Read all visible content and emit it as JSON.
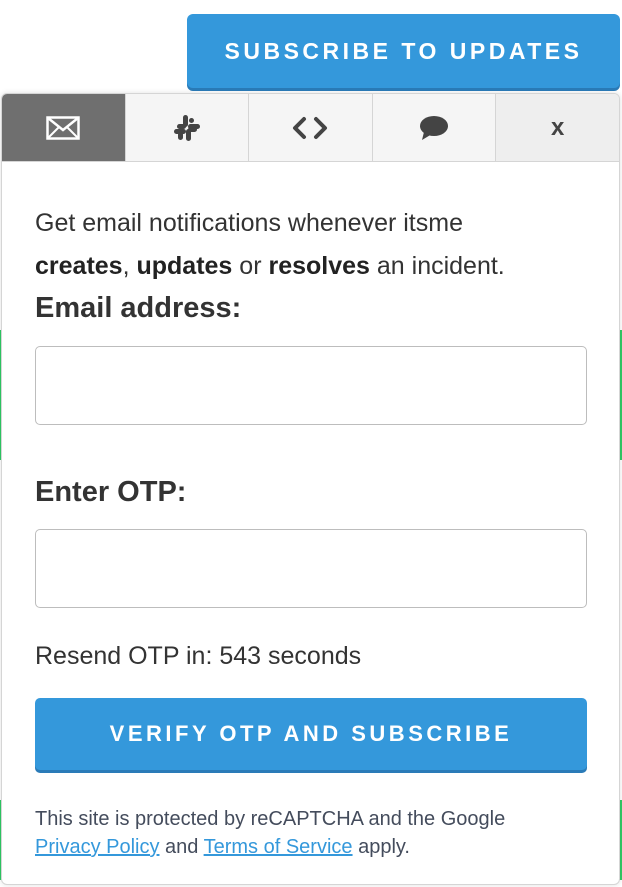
{
  "header": {
    "subscribe_label": "SUBSCRIBE TO UPDATES"
  },
  "tabs": [
    {
      "icon": "email-icon",
      "active": true
    },
    {
      "icon": "slack-icon",
      "active": false
    },
    {
      "icon": "code-icon",
      "active": false
    },
    {
      "icon": "chat-bubble-icon",
      "active": false
    },
    {
      "icon": "close-icon",
      "label": "x",
      "active": false
    }
  ],
  "intro": {
    "prefix": "Get email notifications whenever itsme",
    "w1": "creates",
    "sep1": ", ",
    "w2": "updates",
    "sep2": " or ",
    "w3": "resolves",
    "suffix": " an incident."
  },
  "form": {
    "email_label": "Email address:",
    "email_value": "",
    "otp_label": "Enter OTP:",
    "otp_value": "",
    "resend_text": "Resend OTP in: 543 seconds",
    "verify_label": "VERIFY OTP AND SUBSCRIBE"
  },
  "recaptcha": {
    "line1": "This site is protected by reCAPTCHA and the Google",
    "privacy_link": "Privacy Policy",
    "and": " and ",
    "terms_link": "Terms of Service",
    "apply": " apply."
  },
  "colors": {
    "accent": "#3498db",
    "active_tab": "#6f6f6f"
  }
}
